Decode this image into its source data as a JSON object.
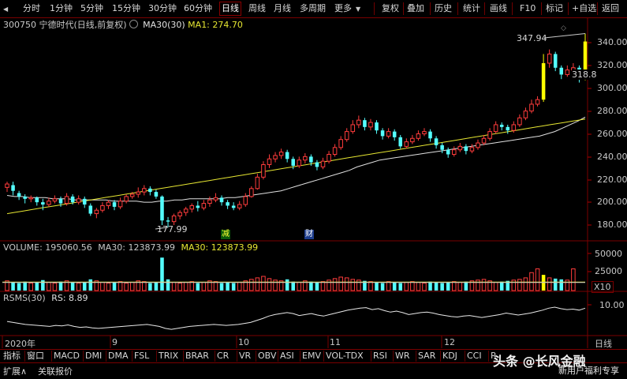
{
  "toolbar": {
    "periods": [
      "分时",
      "1分钟",
      "5分钟",
      "15分钟",
      "30分钟",
      "60分钟",
      "日线",
      "周线",
      "月线",
      "多周期",
      "更多"
    ],
    "active_period": "日线",
    "tools": [
      "复权",
      "叠加",
      "历史",
      "统计",
      "画线",
      "F10",
      "标记",
      "+自选",
      "返回"
    ]
  },
  "info": {
    "stock": "300750 宁德时代(日线,前复权)",
    "ma30": "MA30(30)",
    "ma1": "MA1: 274.70"
  },
  "price_axis": [
    "340.00",
    "320.00",
    "300.00",
    "280.00",
    "260.00",
    "240.00",
    "220.00",
    "200.00",
    "180.00"
  ],
  "annotations": {
    "high": "347.94",
    "low": "177.99",
    "last": "318.8",
    "tag_jian": "减",
    "tag_cai": "财"
  },
  "volume": {
    "header": "VOLUME: 195060.56",
    "ma_label": "MA30: 123873.99",
    "ma_label2": "MA30: 123873.99",
    "axis": [
      "50000",
      "25000"
    ],
    "unit": "X10"
  },
  "rsms": {
    "header": "RSMS(30)",
    "rs": "RS: 8.89",
    "axis": "10.00"
  },
  "date_axis": {
    "labels": [
      "2020年",
      "9",
      "10",
      "11",
      "12"
    ],
    "right": "日线"
  },
  "indicator_tabs": [
    "指标",
    "窗口",
    "MACD",
    "DMI",
    "DMA",
    "FSL",
    "TRIX",
    "BRAR",
    "CR",
    "VR",
    "OBV",
    "ASI",
    "EMV",
    "VOL-TDX",
    "RSI",
    "WR",
    "SAR",
    "KDJ",
    "CCI",
    "R"
  ],
  "bottom": {
    "expand": "扩展∧",
    "related": "关联报价"
  },
  "watermark": {
    "main": "头条 @长风金融",
    "sub": "新用户福利专享"
  },
  "colors": {
    "up": "#ff3c3c",
    "down": "#54ffff",
    "ma30": "#e0e0e0",
    "ma1": "#e6e632",
    "highlight": "#ffff00",
    "grid": "#7a0000"
  },
  "chart_data": {
    "type": "candlestick",
    "price_range": [
      170,
      350
    ],
    "candles": [
      {
        "o": 213,
        "c": 216,
        "h": 218,
        "l": 209
      },
      {
        "o": 215,
        "c": 210,
        "h": 218,
        "l": 206
      },
      {
        "o": 208,
        "c": 205,
        "h": 210,
        "l": 202
      },
      {
        "o": 205,
        "c": 203,
        "h": 207,
        "l": 199
      },
      {
        "o": 203,
        "c": 204,
        "h": 206,
        "l": 200
      },
      {
        "o": 204,
        "c": 200,
        "h": 205,
        "l": 197
      },
      {
        "o": 200,
        "c": 198,
        "h": 203,
        "l": 193
      },
      {
        "o": 198,
        "c": 201,
        "h": 204,
        "l": 196
      },
      {
        "o": 201,
        "c": 203,
        "h": 206,
        "l": 199
      },
      {
        "o": 203,
        "c": 199,
        "h": 205,
        "l": 196
      },
      {
        "o": 199,
        "c": 205,
        "h": 208,
        "l": 197
      },
      {
        "o": 205,
        "c": 200,
        "h": 207,
        "l": 198
      },
      {
        "o": 200,
        "c": 203,
        "h": 206,
        "l": 198
      },
      {
        "o": 203,
        "c": 198,
        "h": 205,
        "l": 195
      },
      {
        "o": 197,
        "c": 190,
        "h": 199,
        "l": 188
      },
      {
        "o": 190,
        "c": 193,
        "h": 195,
        "l": 186
      },
      {
        "o": 193,
        "c": 197,
        "h": 200,
        "l": 191
      },
      {
        "o": 197,
        "c": 200,
        "h": 202,
        "l": 194
      },
      {
        "o": 200,
        "c": 196,
        "h": 202,
        "l": 193
      },
      {
        "o": 196,
        "c": 201,
        "h": 204,
        "l": 194
      },
      {
        "o": 201,
        "c": 205,
        "h": 207,
        "l": 199
      },
      {
        "o": 205,
        "c": 207,
        "h": 209,
        "l": 203
      },
      {
        "o": 207,
        "c": 209,
        "h": 213,
        "l": 204
      },
      {
        "o": 209,
        "c": 212,
        "h": 215,
        "l": 206
      },
      {
        "o": 212,
        "c": 209,
        "h": 214,
        "l": 206
      },
      {
        "o": 209,
        "c": 205,
        "h": 211,
        "l": 203
      },
      {
        "o": 205,
        "c": 184,
        "h": 206,
        "l": 180
      },
      {
        "o": 184,
        "c": 183,
        "h": 187,
        "l": 178
      },
      {
        "o": 183,
        "c": 188,
        "h": 190,
        "l": 180
      },
      {
        "o": 188,
        "c": 191,
        "h": 193,
        "l": 185
      },
      {
        "o": 191,
        "c": 194,
        "h": 196,
        "l": 188
      },
      {
        "o": 194,
        "c": 197,
        "h": 199,
        "l": 191
      },
      {
        "o": 197,
        "c": 195,
        "h": 201,
        "l": 192
      },
      {
        "o": 195,
        "c": 199,
        "h": 202,
        "l": 193
      },
      {
        "o": 199,
        "c": 202,
        "h": 205,
        "l": 196
      },
      {
        "o": 202,
        "c": 204,
        "h": 208,
        "l": 200
      },
      {
        "o": 204,
        "c": 200,
        "h": 206,
        "l": 197
      },
      {
        "o": 200,
        "c": 197,
        "h": 202,
        "l": 194
      },
      {
        "o": 197,
        "c": 195,
        "h": 200,
        "l": 193
      },
      {
        "o": 195,
        "c": 198,
        "h": 201,
        "l": 193
      },
      {
        "o": 198,
        "c": 205,
        "h": 208,
        "l": 196
      },
      {
        "o": 205,
        "c": 212,
        "h": 214,
        "l": 204
      },
      {
        "o": 212,
        "c": 222,
        "h": 225,
        "l": 211
      },
      {
        "o": 222,
        "c": 233,
        "h": 236,
        "l": 220
      },
      {
        "o": 233,
        "c": 238,
        "h": 242,
        "l": 230
      },
      {
        "o": 238,
        "c": 241,
        "h": 244,
        "l": 235
      },
      {
        "o": 241,
        "c": 244,
        "h": 247,
        "l": 238
      },
      {
        "o": 244,
        "c": 238,
        "h": 246,
        "l": 235
      },
      {
        "o": 238,
        "c": 232,
        "h": 240,
        "l": 229
      },
      {
        "o": 232,
        "c": 237,
        "h": 240,
        "l": 230
      },
      {
        "o": 237,
        "c": 240,
        "h": 243,
        "l": 234
      },
      {
        "o": 240,
        "c": 235,
        "h": 242,
        "l": 232
      },
      {
        "o": 235,
        "c": 231,
        "h": 237,
        "l": 228
      },
      {
        "o": 231,
        "c": 236,
        "h": 239,
        "l": 229
      },
      {
        "o": 236,
        "c": 242,
        "h": 245,
        "l": 234
      },
      {
        "o": 242,
        "c": 248,
        "h": 251,
        "l": 240
      },
      {
        "o": 248,
        "c": 255,
        "h": 258,
        "l": 246
      },
      {
        "o": 255,
        "c": 262,
        "h": 265,
        "l": 253
      },
      {
        "o": 262,
        "c": 268,
        "h": 272,
        "l": 260
      },
      {
        "o": 268,
        "c": 272,
        "h": 276,
        "l": 265
      },
      {
        "o": 272,
        "c": 266,
        "h": 274,
        "l": 263
      },
      {
        "o": 266,
        "c": 270,
        "h": 273,
        "l": 263
      },
      {
        "o": 270,
        "c": 263,
        "h": 272,
        "l": 260
      },
      {
        "o": 263,
        "c": 258,
        "h": 265,
        "l": 255
      },
      {
        "o": 258,
        "c": 262,
        "h": 265,
        "l": 256
      },
      {
        "o": 262,
        "c": 257,
        "h": 264,
        "l": 254
      },
      {
        "o": 257,
        "c": 249,
        "h": 259,
        "l": 247
      },
      {
        "o": 249,
        "c": 253,
        "h": 256,
        "l": 247
      },
      {
        "o": 253,
        "c": 256,
        "h": 259,
        "l": 251
      },
      {
        "o": 256,
        "c": 260,
        "h": 263,
        "l": 254
      },
      {
        "o": 260,
        "c": 262,
        "h": 265,
        "l": 258
      },
      {
        "o": 262,
        "c": 256,
        "h": 264,
        "l": 253
      },
      {
        "o": 256,
        "c": 250,
        "h": 258,
        "l": 247
      },
      {
        "o": 250,
        "c": 246,
        "h": 252,
        "l": 243
      },
      {
        "o": 246,
        "c": 242,
        "h": 248,
        "l": 239
      },
      {
        "o": 242,
        "c": 246,
        "h": 249,
        "l": 240
      },
      {
        "o": 246,
        "c": 249,
        "h": 252,
        "l": 244
      },
      {
        "o": 249,
        "c": 245,
        "h": 251,
        "l": 242
      },
      {
        "o": 245,
        "c": 248,
        "h": 251,
        "l": 243
      },
      {
        "o": 248,
        "c": 252,
        "h": 255,
        "l": 246
      },
      {
        "o": 252,
        "c": 256,
        "h": 259,
        "l": 250
      },
      {
        "o": 256,
        "c": 262,
        "h": 265,
        "l": 254
      },
      {
        "o": 262,
        "c": 268,
        "h": 271,
        "l": 260
      },
      {
        "o": 268,
        "c": 266,
        "h": 270,
        "l": 263
      },
      {
        "o": 266,
        "c": 263,
        "h": 268,
        "l": 260
      },
      {
        "o": 263,
        "c": 268,
        "h": 271,
        "l": 261
      },
      {
        "o": 268,
        "c": 274,
        "h": 277,
        "l": 266
      },
      {
        "o": 274,
        "c": 280,
        "h": 283,
        "l": 272
      },
      {
        "o": 280,
        "c": 286,
        "h": 290,
        "l": 278
      },
      {
        "o": 286,
        "c": 290,
        "h": 293,
        "l": 284
      },
      {
        "o": 290,
        "c": 322,
        "h": 330,
        "l": 288
      },
      {
        "o": 322,
        "c": 330,
        "h": 334,
        "l": 318
      },
      {
        "o": 330,
        "c": 318,
        "h": 332,
        "l": 315
      },
      {
        "o": 318,
        "c": 312,
        "h": 320,
        "l": 308
      },
      {
        "o": 312,
        "c": 316,
        "h": 320,
        "l": 310
      },
      {
        "o": 316,
        "c": 318,
        "h": 322,
        "l": 313
      },
      {
        "o": 318,
        "c": 308,
        "h": 320,
        "l": 305
      },
      {
        "o": 308,
        "c": 341,
        "h": 347.94,
        "l": 307
      }
    ],
    "ma30": [
      206,
      205,
      205,
      204,
      204,
      204,
      203,
      203,
      203,
      202,
      202,
      202,
      202,
      202,
      201,
      201,
      201,
      201,
      200,
      200,
      201,
      201,
      202,
      202,
      203,
      203,
      203,
      203,
      203,
      204,
      204,
      205,
      206,
      207,
      208,
      209,
      210,
      212,
      214,
      216,
      218,
      220,
      222,
      224,
      226,
      228,
      231,
      233,
      235,
      237,
      238,
      239,
      240,
      241,
      242,
      243,
      244,
      245,
      246,
      247,
      248,
      249,
      250,
      251,
      252,
      253,
      254,
      255,
      256,
      257,
      258,
      260,
      262,
      265,
      268,
      271,
      274.7
    ],
    "ma1": [
      190,
      191,
      192,
      193,
      194,
      195,
      196,
      197,
      198,
      199,
      200,
      201,
      202,
      203,
      204,
      205,
      206,
      207,
      208,
      209,
      210,
      211,
      212,
      213,
      214,
      215,
      216,
      217,
      218,
      219,
      220,
      221,
      222,
      223,
      224,
      225,
      226,
      227,
      228,
      229,
      230,
      231,
      232,
      233,
      234,
      235,
      236,
      237,
      238,
      239,
      240,
      241,
      242,
      243,
      244,
      245,
      246,
      247,
      248,
      249,
      250,
      251,
      252,
      253,
      254,
      255,
      256,
      257,
      258,
      259,
      260,
      261,
      262,
      263,
      264,
      265,
      266,
      267,
      268,
      269,
      270,
      271,
      272,
      273
    ],
    "volume_range": [
      0,
      60000
    ],
    "volume": [
      14000,
      12000,
      11000,
      13000,
      11000,
      12000,
      15000,
      12000,
      11000,
      13000,
      14000,
      12000,
      11000,
      12000,
      16000,
      14000,
      12000,
      11000,
      12000,
      13000,
      11000,
      12000,
      14000,
      13000,
      11000,
      12000,
      45000,
      16000,
      12000,
      11000,
      12000,
      13000,
      11000,
      12000,
      14000,
      13000,
      11000,
      12000,
      11000,
      12000,
      14000,
      16000,
      18000,
      20000,
      17000,
      15000,
      14000,
      16000,
      13000,
      12000,
      14000,
      13000,
      12000,
      13000,
      15000,
      17000,
      19000,
      18000,
      16000,
      15000,
      14000,
      13000,
      12000,
      11000,
      13000,
      12000,
      11000,
      12000,
      13000,
      12000,
      11000,
      13000,
      12000,
      11000,
      12000,
      13000,
      12000,
      13000,
      14000,
      15000,
      16000,
      14000,
      12000,
      13000,
      14000,
      15000,
      16000,
      18000,
      25000,
      30000,
      22000,
      18000,
      17000,
      16000,
      15000,
      30000
    ],
    "rs": [
      6.2,
      6.0,
      5.8,
      5.6,
      5.5,
      5.4,
      5.3,
      5.2,
      5.4,
      5.3,
      5.5,
      5.2,
      5.0,
      5.1,
      4.9,
      4.8,
      4.9,
      5.0,
      5.1,
      5.2,
      5.3,
      5.4,
      5.5,
      5.6,
      5.4,
      5.2,
      4.8,
      4.6,
      4.8,
      5.0,
      5.2,
      5.3,
      5.4,
      5.5,
      5.6,
      5.5,
      5.4,
      5.5,
      5.6,
      5.8,
      6.0,
      6.4,
      6.8,
      7.3,
      7.6,
      7.8,
      8.0,
      7.8,
      7.4,
      7.6,
      7.8,
      7.5,
      7.3,
      7.6,
      7.9,
      8.2,
      8.5,
      8.7,
      8.9,
      9.0,
      8.6,
      8.8,
      8.4,
      8.1,
      8.3,
      8.0,
      7.6,
      7.8,
      8.0,
      8.1,
      7.9,
      7.6,
      7.4,
      7.2,
      7.1,
      7.3,
      7.4,
      7.2,
      7.0,
      7.2,
      7.4,
      7.6,
      7.9,
      7.7,
      7.5,
      7.7,
      7.9,
      8.2,
      8.5,
      8.9,
      9.1,
      8.8,
      8.6,
      8.7,
      8.5,
      8.89
    ],
    "rs_range": [
      3.5,
      11.5
    ]
  }
}
